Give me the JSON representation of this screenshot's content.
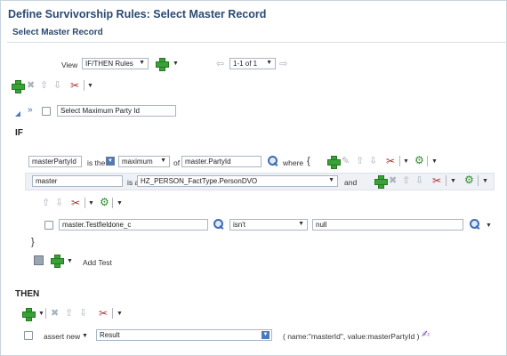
{
  "header": {
    "title": "Define Survivorship Rules: Select Master Record",
    "subtitle": "Select Master Record"
  },
  "toolbar": {
    "view_label": "View",
    "view_value": "IF/THEN Rules",
    "pager_value": "1-1 of 1"
  },
  "rule": {
    "name": "Select Maximum Party Id"
  },
  "if_section": {
    "label": "IF",
    "condition1": {
      "field": "masterPartyId",
      "is_the": "is the",
      "aggregate": "maximum",
      "of": "of",
      "of_value": "master.PartyId",
      "where": "where",
      "open_brace": "{"
    },
    "condition2": {
      "var": "master",
      "is_a": "is a",
      "type": "HZ_PERSON_FactType.PersonDVO",
      "and": "and"
    },
    "test": {
      "field": "master.Testfieldone_c",
      "operator": "isn't",
      "value": "null"
    },
    "close_brace": "}",
    "add_test": "Add Test"
  },
  "then_section": {
    "label": "THEN",
    "action": "assert new",
    "target": "Result",
    "args": "( name:\"masterId\", value:masterPartyId )"
  },
  "colors": {
    "title": "#2b4a72",
    "add_green": "#39a03a",
    "delete_red": "#b03030",
    "search_blue": "#3d6db0"
  }
}
